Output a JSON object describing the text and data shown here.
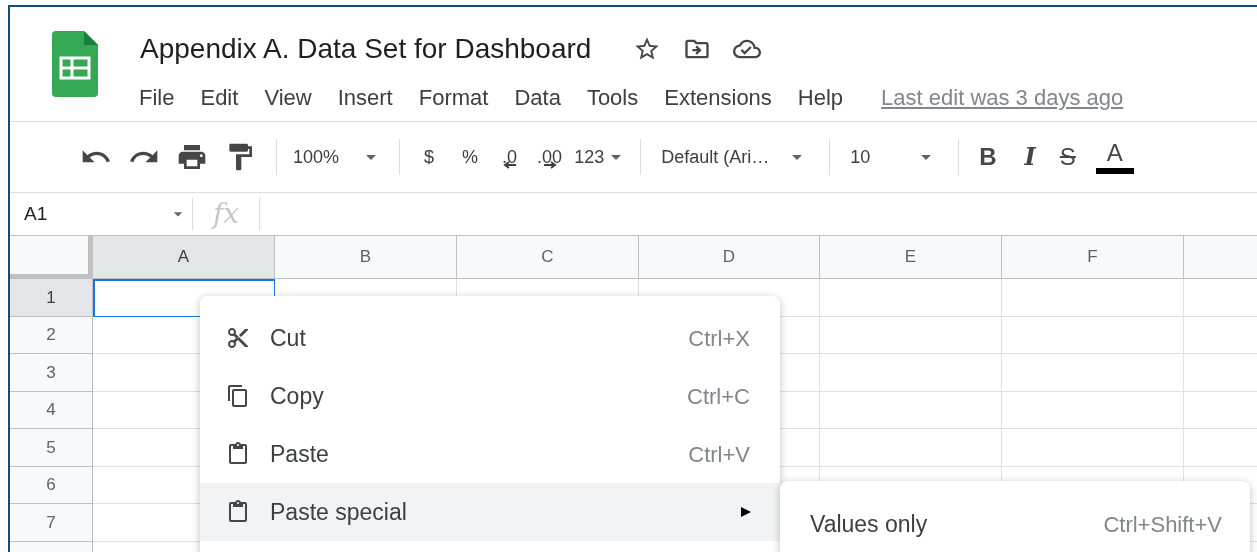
{
  "document": {
    "title": "Appendix A. Data Set for Dashboard"
  },
  "menu_bar": {
    "items": [
      "File",
      "Edit",
      "View",
      "Insert",
      "Format",
      "Data",
      "Tools",
      "Extensions",
      "Help"
    ],
    "last_edit": "Last edit was 3 days ago"
  },
  "toolbar": {
    "zoom": "100%",
    "currency": "$",
    "percent": "%",
    "decrease_decimal": ".0",
    "increase_decimal": ".00",
    "number_format": "123",
    "font": "Default (Ari…",
    "font_size": "10",
    "bold": "B",
    "italic": "I",
    "strikethrough": "S",
    "text_color": "A"
  },
  "formula_bar": {
    "cell_reference": "A1",
    "fx": "fx"
  },
  "grid": {
    "columns": [
      {
        "label": "A",
        "selected": true
      },
      {
        "label": "B",
        "selected": false
      },
      {
        "label": "C",
        "selected": false
      },
      {
        "label": "D",
        "selected": false
      },
      {
        "label": "E",
        "selected": false
      },
      {
        "label": "F",
        "selected": false
      }
    ],
    "rows": [
      {
        "label": "1",
        "selected": true
      },
      {
        "label": "2",
        "selected": false
      },
      {
        "label": "3",
        "selected": false
      },
      {
        "label": "4",
        "selected": false
      },
      {
        "label": "5",
        "selected": false
      },
      {
        "label": "6",
        "selected": false
      },
      {
        "label": "7",
        "selected": false
      }
    ]
  },
  "context_menu": {
    "items": [
      {
        "kind": "cut",
        "label": "Cut",
        "shortcut": "Ctrl+X",
        "selected": false
      },
      {
        "kind": "copy",
        "label": "Copy",
        "shortcut": "Ctrl+C",
        "selected": false
      },
      {
        "kind": "paste",
        "label": "Paste",
        "shortcut": "Ctrl+V",
        "selected": false
      },
      {
        "kind": "submenu",
        "label": "Paste special",
        "selected": true
      }
    ],
    "submenu": {
      "items": [
        {
          "label": "Values only",
          "shortcut": "Ctrl+Shift+V"
        }
      ]
    }
  }
}
